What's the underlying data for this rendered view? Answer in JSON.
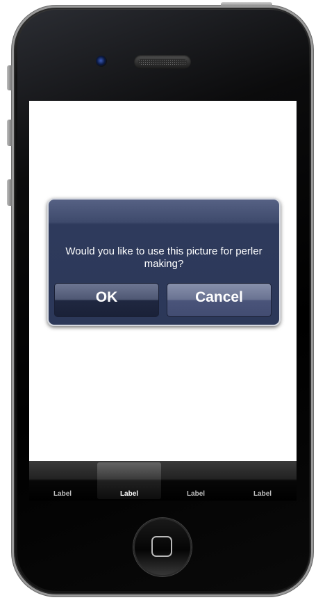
{
  "device": {
    "icons": {
      "camera": "front-camera-icon",
      "speaker": "earpiece-speaker-icon",
      "home": "home-button-icon"
    }
  },
  "alert": {
    "message": "Would you like to use this picture for perler making?",
    "ok_label": "OK",
    "cancel_label": "Cancel"
  },
  "tabbar": {
    "tabs": [
      {
        "label": "Label",
        "selected": false
      },
      {
        "label": "Label",
        "selected": true
      },
      {
        "label": "Label",
        "selected": false
      },
      {
        "label": "Label",
        "selected": false
      }
    ]
  },
  "colors": {
    "alert_background": "#2c3859",
    "alert_border": "#d6d9e0",
    "tabbar_background": "#000000",
    "screen_background": "#ffffff"
  }
}
